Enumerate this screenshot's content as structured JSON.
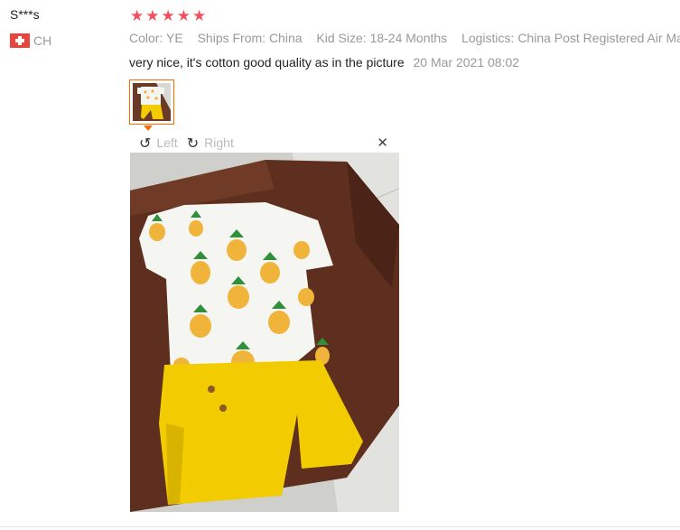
{
  "user": {
    "name": "S***s",
    "country_code": "CH"
  },
  "rating": {
    "stars": 5,
    "star_color": "#f44f5e"
  },
  "attributes": [
    {
      "label": "Color:",
      "value": "YE"
    },
    {
      "label": "Ships From:",
      "value": "China"
    },
    {
      "label": "Kid Size:",
      "value": "18-24 Months"
    },
    {
      "label": "Logistics:",
      "value": "China Post Registered Air Mail"
    }
  ],
  "review": {
    "text": "very nice, it's cotton good quality as in the picture",
    "date": "20 Mar 2021 08:02"
  },
  "viewer": {
    "left_label": "Left",
    "right_label": "Right",
    "close_glyph": "✕"
  },
  "colors": {
    "accent": "#ff6a00"
  }
}
